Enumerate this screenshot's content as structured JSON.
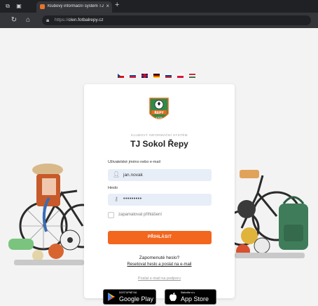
{
  "browser": {
    "tab_title": "Klubový informační systém TJ So",
    "close_glyph": "×",
    "new_tab_glyph": "+",
    "url_prefix": "https://",
    "url_host": "clen.fotbalrepy.cz"
  },
  "languages": [
    "cs",
    "sk",
    "en",
    "de",
    "ru",
    "pl",
    "hu"
  ],
  "login": {
    "system_label": "KLUBOVÝ INFORMAČNÍ SYSTÉM",
    "club_name": "TJ Sokol Řepy",
    "logo_text": "ŘEPY",
    "logo_year": "1926",
    "username_label": "Uživatelské jméno nebo e-mail",
    "username_value": "jan.novak",
    "password_label": "Heslo",
    "password_value": "•••••••••",
    "remember_label": "zapamatovat přihlášení",
    "submit_label": "PŘIHLÁSIT",
    "forgot_text": "Zapomenuté heslo?",
    "reset_link": "Resetovat heslo a poslat na e-mail",
    "support_link": "Poslat e-mail na podporu"
  },
  "stores": {
    "google_small": "DOSTUPNÉ NA",
    "google_big": "Google Play",
    "apple_small": "Stáhněte si v",
    "apple_big": "App Store"
  },
  "colors": {
    "accent": "#f2661e",
    "field_bg": "#e7eef8",
    "logo_green": "#2e8b4a"
  }
}
